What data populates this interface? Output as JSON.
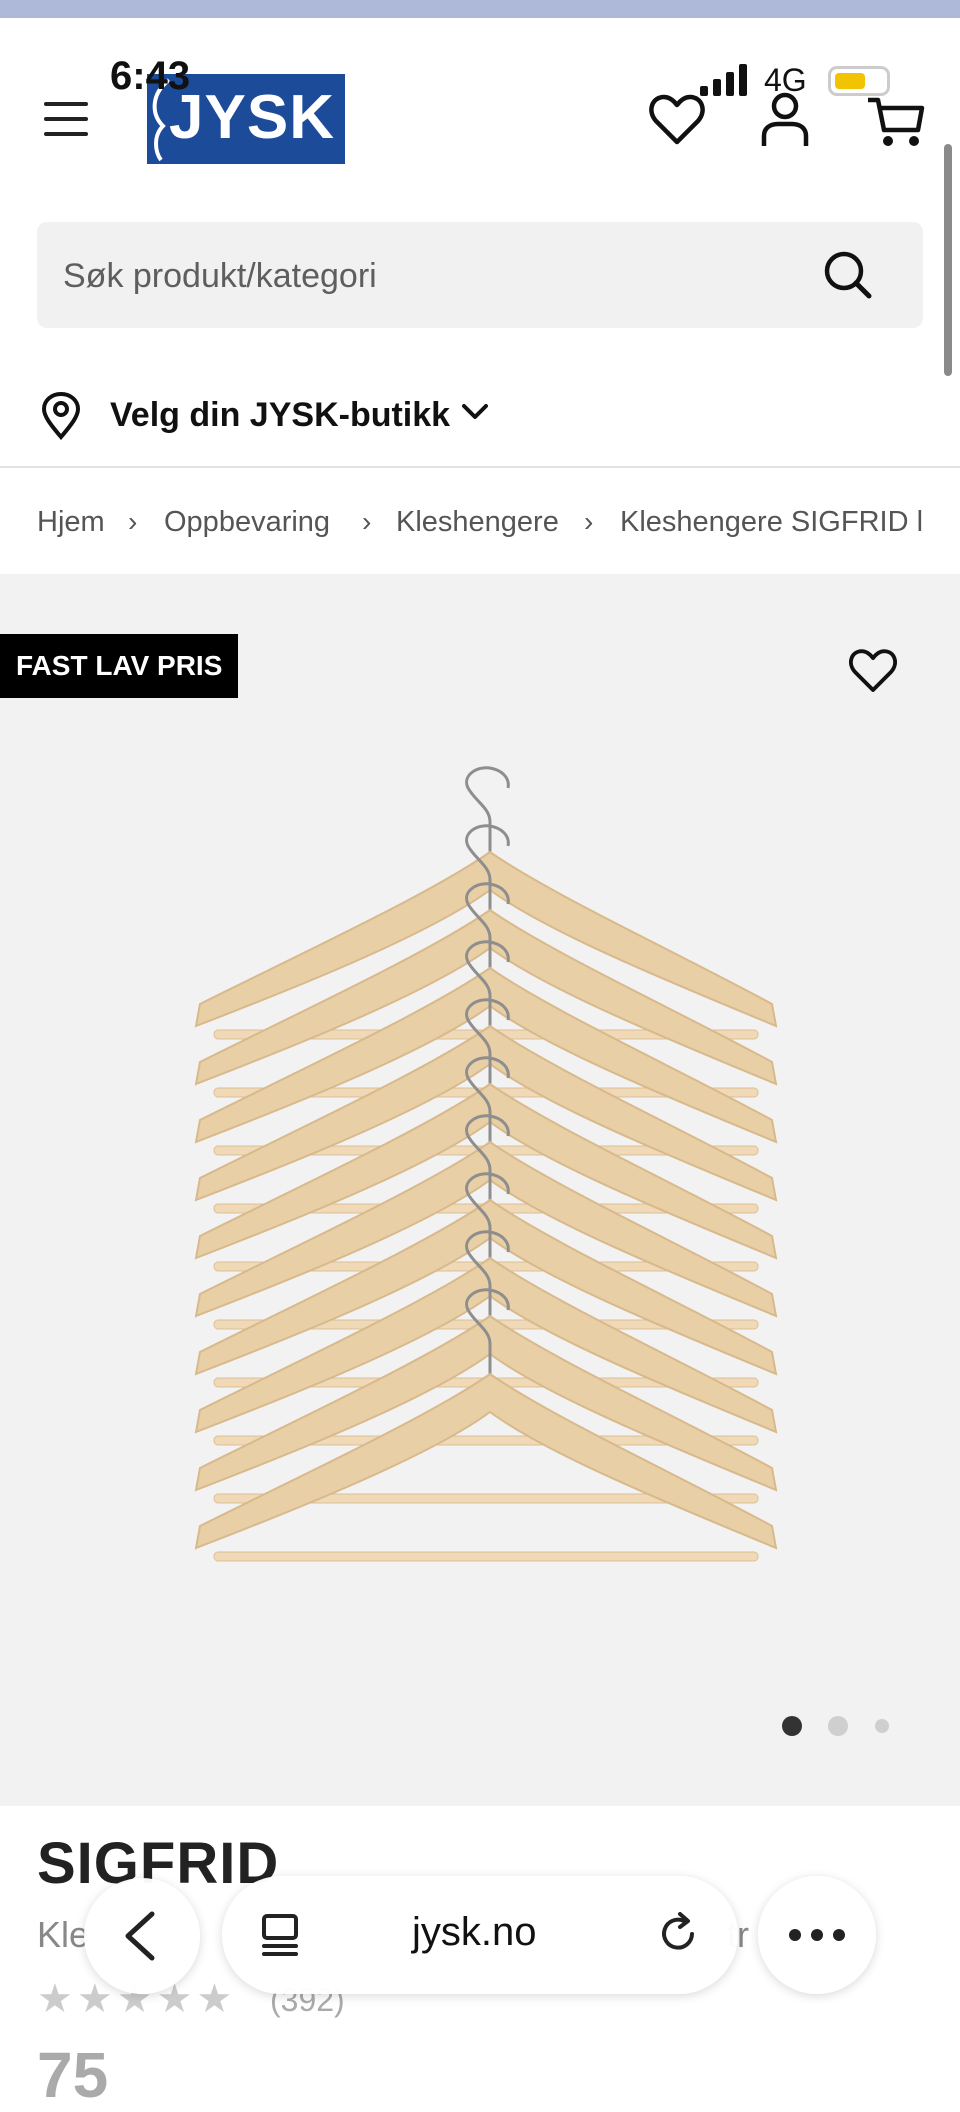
{
  "status_bar": {
    "time": "6:43",
    "network": "4G",
    "battery_level": 0.6
  },
  "header": {
    "logo_text": "JYSK",
    "brand_color": "#1c4b9a",
    "icons": [
      "menu-icon",
      "wishlist-heart-icon",
      "account-icon",
      "cart-icon"
    ]
  },
  "search": {
    "placeholder": "Søk produkt/kategori",
    "icon": "search-icon"
  },
  "store": {
    "label": "Velg din JYSK-butikk",
    "icon": "location-pin-icon"
  },
  "breadcrumb": [
    "Hjem",
    "Oppbevaring",
    "Kleshengere",
    "Kleshengere SIGFRID l"
  ],
  "gallery": {
    "badge": "FAST LAV PRIS",
    "image": "wooden-hangers-product-image",
    "dots": {
      "count": 3,
      "active": 1
    }
  },
  "product": {
    "title": "SIGFRID",
    "subtitle_partial": "Kle",
    "subtitle_partial_2": "tr",
    "rating": 4.5,
    "reviews": "(392)",
    "price_partial": "75"
  },
  "browser": {
    "url": "jysk.no"
  },
  "colors": {
    "badge_bg": "#000000",
    "gallery_bg": "#f2f2f2",
    "search_bg": "#f1f1f1"
  }
}
